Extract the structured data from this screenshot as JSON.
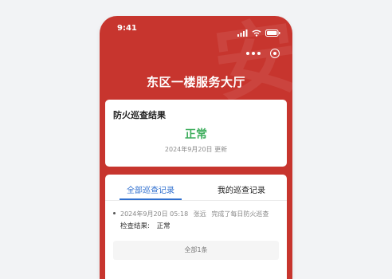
{
  "status_bar": {
    "time": "9:41"
  },
  "header": {
    "title": "东区一楼服务大厅",
    "watermark_char": "安"
  },
  "result_card": {
    "title": "防火巡查结果",
    "status": "正常",
    "date_text": "2024年9月20日 更新",
    "status_color": "#3fae5e"
  },
  "tabs": [
    {
      "label": "全部巡查记录",
      "active": true
    },
    {
      "label": "我的巡查记录",
      "active": false
    }
  ],
  "records": [
    {
      "datetime": "2024年9月20日 05:18",
      "person": "张远",
      "action": "完成了每日防火巡查",
      "result_label": "检查结果:",
      "result_value": "正常"
    }
  ],
  "total_text": "全部1条",
  "colors": {
    "brand_red": "#c7352e",
    "accent_blue": "#2f6fcf"
  },
  "icons": [
    "signal-icon",
    "wifi-icon",
    "battery-icon",
    "more-dots-icon",
    "target-icon"
  ]
}
